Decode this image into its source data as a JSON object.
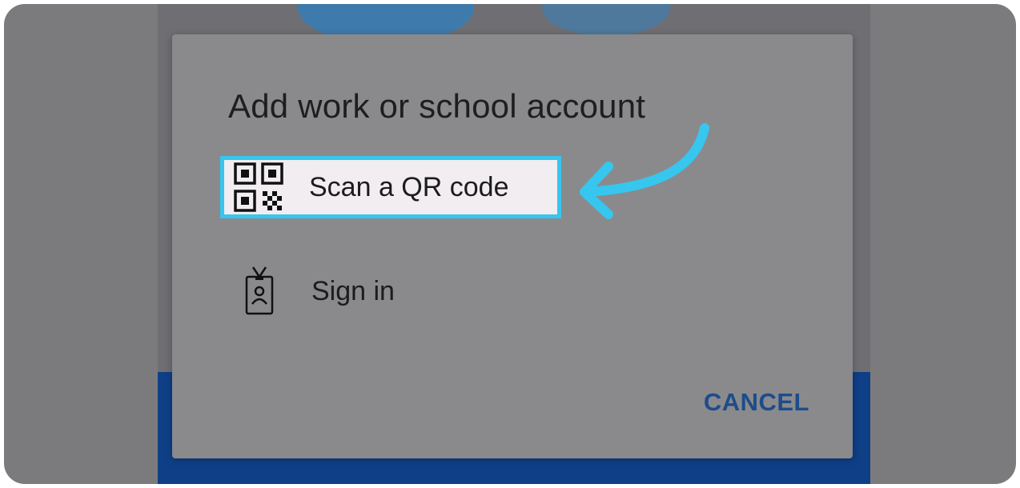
{
  "dialog": {
    "title": "Add work or school account",
    "options": [
      {
        "label": "Scan a QR code",
        "icon": "qr-code-icon"
      },
      {
        "label": "Sign in",
        "icon": "badge-icon"
      }
    ],
    "cancel_label": "CANCEL"
  },
  "colors": {
    "highlight": "#36c6ee",
    "cancel": "#1d4c8a",
    "dialog_bg": "#8a8a8c",
    "overlay_bg": "#7b7b7d"
  }
}
